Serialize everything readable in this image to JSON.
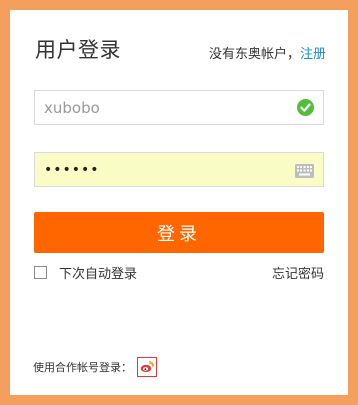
{
  "colors": {
    "frame": "#f59f5f",
    "primary_button": "#ff6600",
    "link": "#1a8ad8",
    "valid_check": "#52bf3b",
    "password_bg": "#fafcc6"
  },
  "header": {
    "title": "用户登录",
    "no_account_text": "没有东奥帐户，",
    "register_link": "注册"
  },
  "form": {
    "username_value": "xubobo",
    "username_status_icon": "checkmark-icon",
    "password_value": "••••••",
    "password_icon": "keyboard-icon",
    "login_button": "登录",
    "remember_label": "下次自动登录",
    "remember_checked": false,
    "forgot_password": "忘记密码"
  },
  "partner": {
    "label": "使用合作帐号登录：",
    "icon": "weibo-icon"
  }
}
